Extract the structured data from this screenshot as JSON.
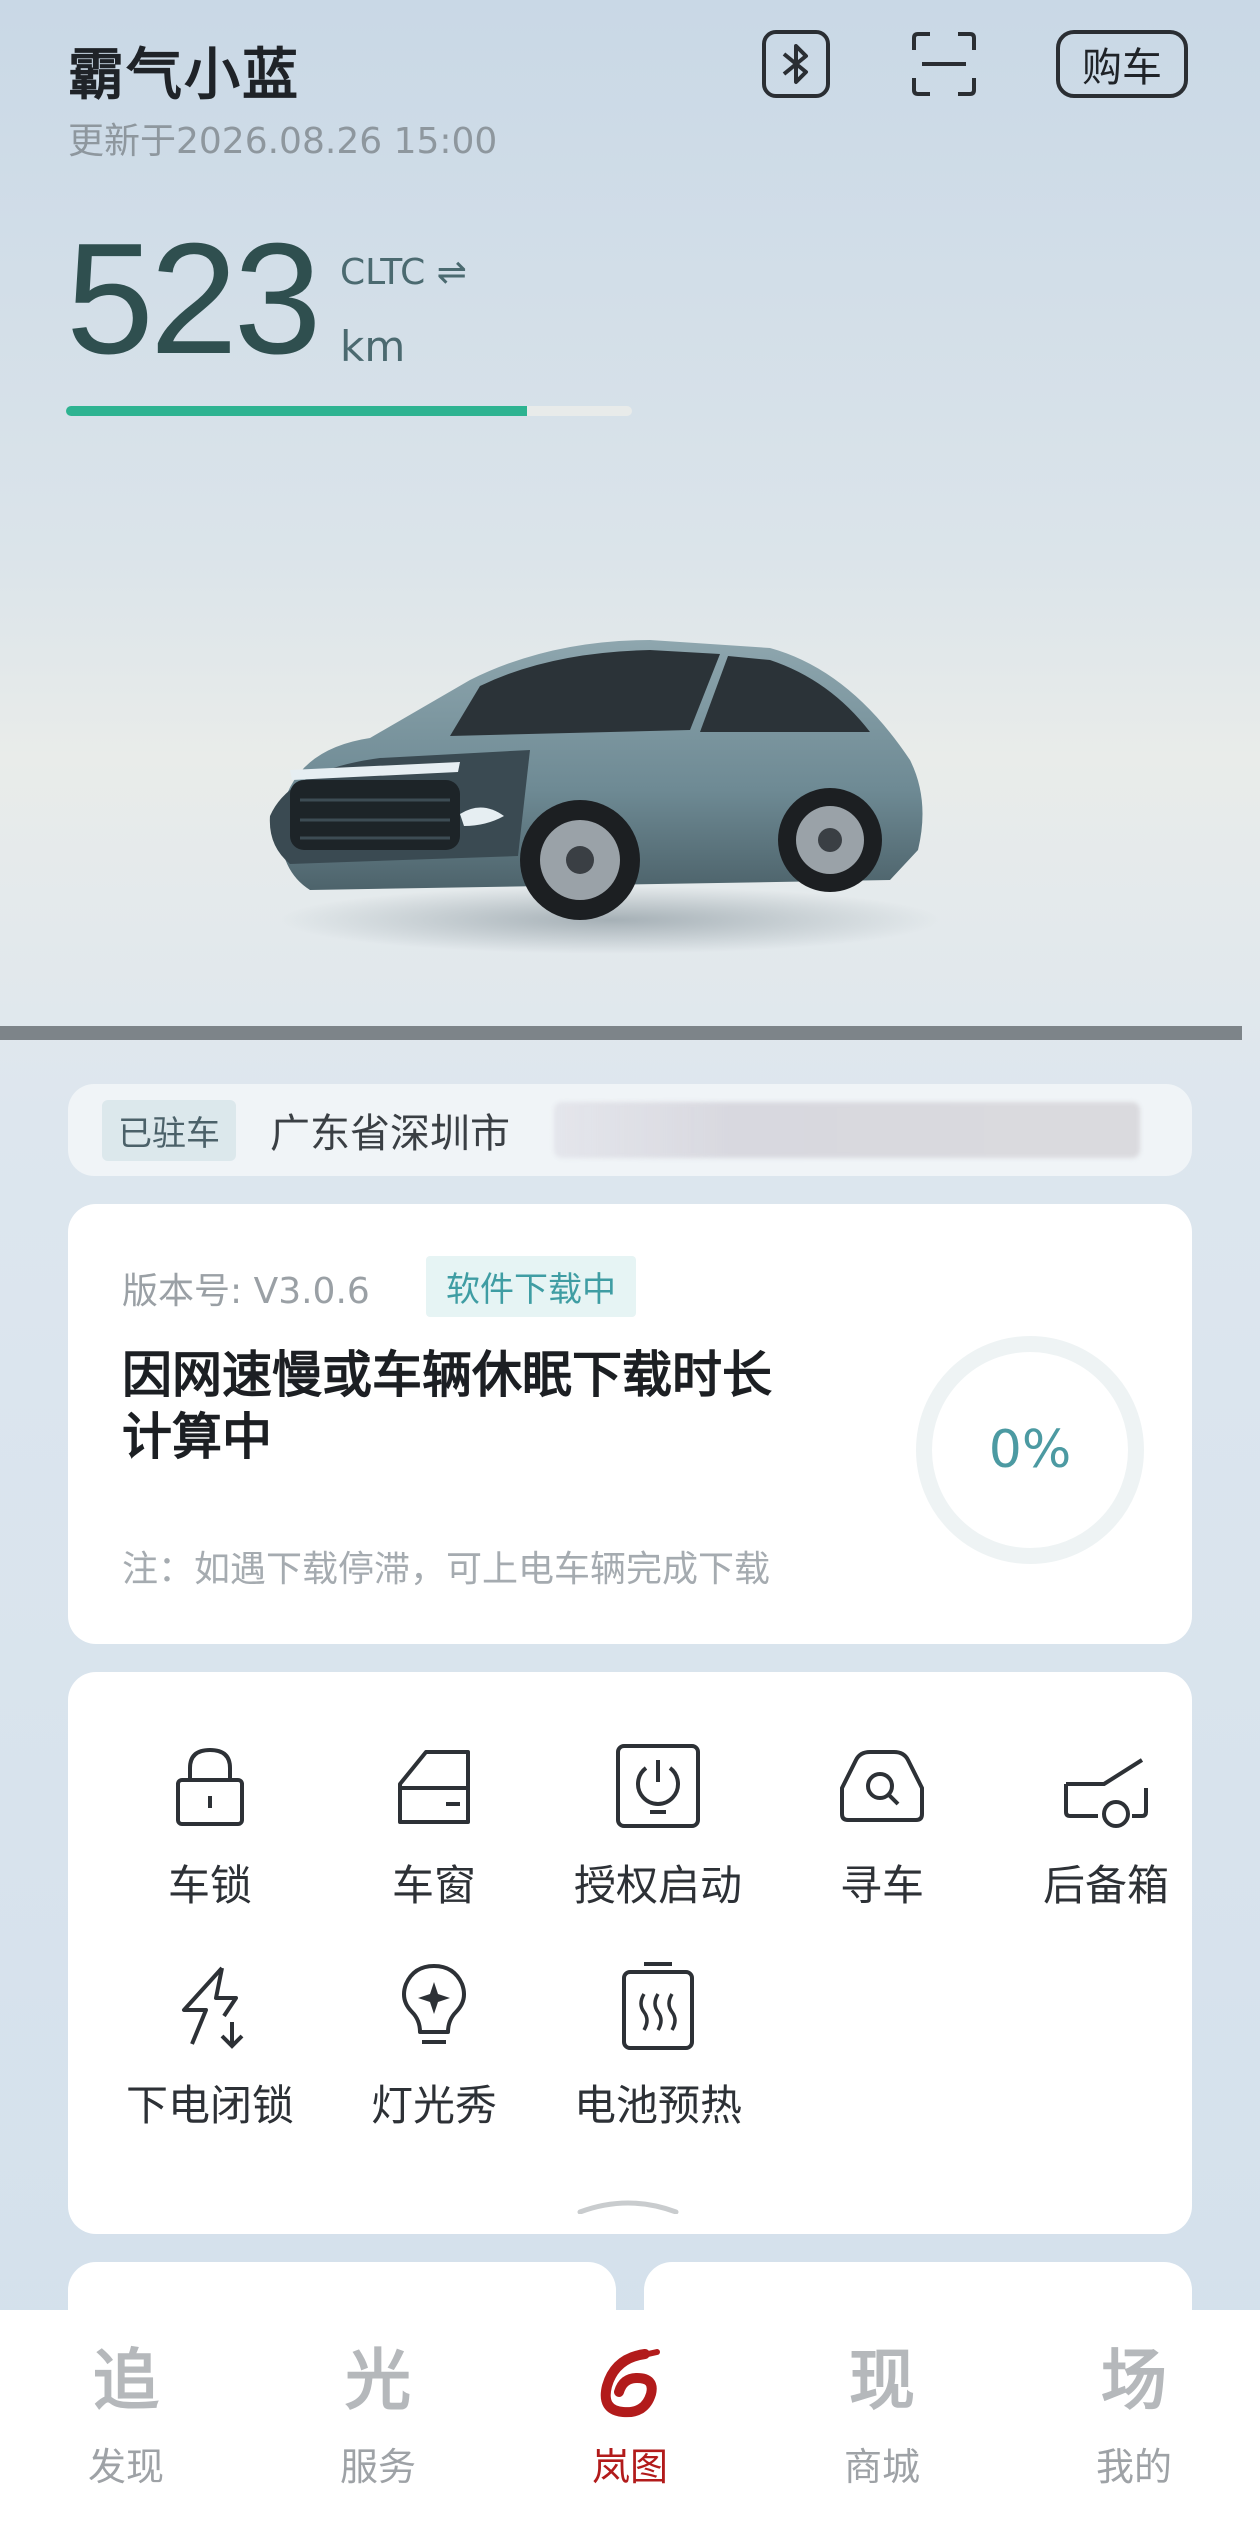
{
  "header": {
    "car_name": "霸气小蓝",
    "updated": "更新于2026.08.26 15:00",
    "buy_label": "购车",
    "range_value": "523",
    "range_standard": "CLTC ⇌",
    "range_unit": "km",
    "range_fill_fraction": 0.815,
    "accent_color": "#2db391"
  },
  "location": {
    "status": "已驻车",
    "address": "广东省深圳市"
  },
  "ota": {
    "version_label": "版本号:  V3.0.6",
    "status_badge": "软件下载中",
    "message": "因网速慢或车辆休眠下载时长计算中",
    "note": "注：如遇下载停滞，可上电车辆完成下载",
    "progress": "0%"
  },
  "controls": [
    {
      "label": "车锁",
      "icon": "lock-icon"
    },
    {
      "label": "车窗",
      "icon": "car-window-icon"
    },
    {
      "label": "授权启动",
      "icon": "power-authorize-icon"
    },
    {
      "label": "寻车",
      "icon": "find-car-icon"
    },
    {
      "label": "后备箱",
      "icon": "trunk-icon"
    },
    {
      "label": "下电闭锁",
      "icon": "power-off-lock-icon"
    },
    {
      "label": "灯光秀",
      "icon": "light-show-icon"
    },
    {
      "label": "电池预热",
      "icon": "battery-preheat-icon"
    }
  ],
  "tabbar": [
    {
      "glyph": "追",
      "label": "发现"
    },
    {
      "glyph": "光",
      "label": "服务"
    },
    {
      "glyph": "",
      "label": "岚图",
      "active": true
    },
    {
      "glyph": "现",
      "label": "商城"
    },
    {
      "glyph": "场",
      "label": "我的"
    }
  ]
}
